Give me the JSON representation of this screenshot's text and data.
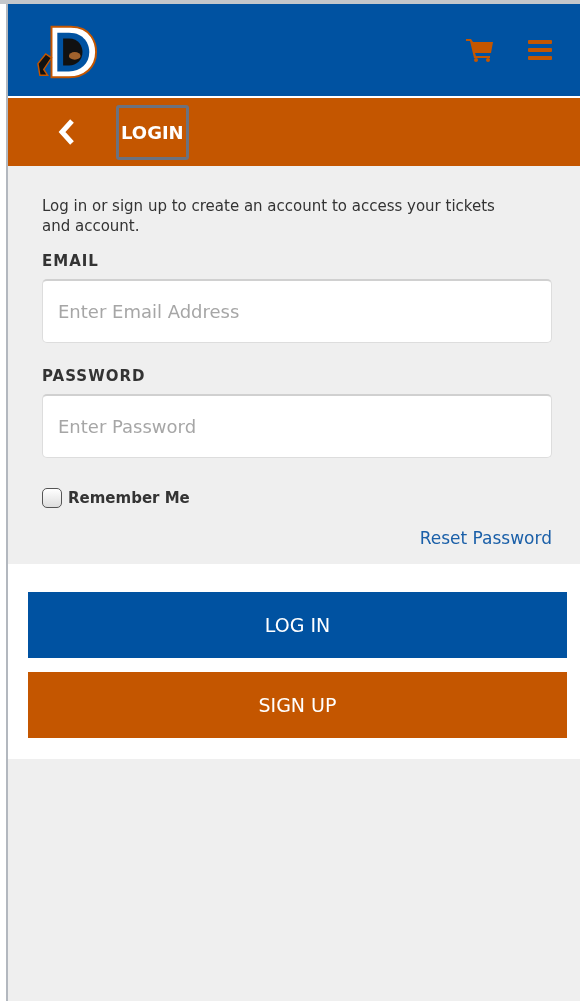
{
  "subheader": {
    "title": "LOGIN"
  },
  "intro": "Log in or sign up to create an account to access your tickets and account.",
  "fields": [
    {
      "label": "EMAIL",
      "placeholder": "Enter Email Address"
    },
    {
      "label": "PASSWORD",
      "placeholder": "Enter Password"
    }
  ],
  "remember": {
    "label": "Remember Me",
    "checked": false
  },
  "reset_link": "Reset Password",
  "buttons": [
    {
      "label": "LOG IN",
      "kind": "primary"
    },
    {
      "label": "SIGN UP",
      "kind": "secondary"
    }
  ]
}
